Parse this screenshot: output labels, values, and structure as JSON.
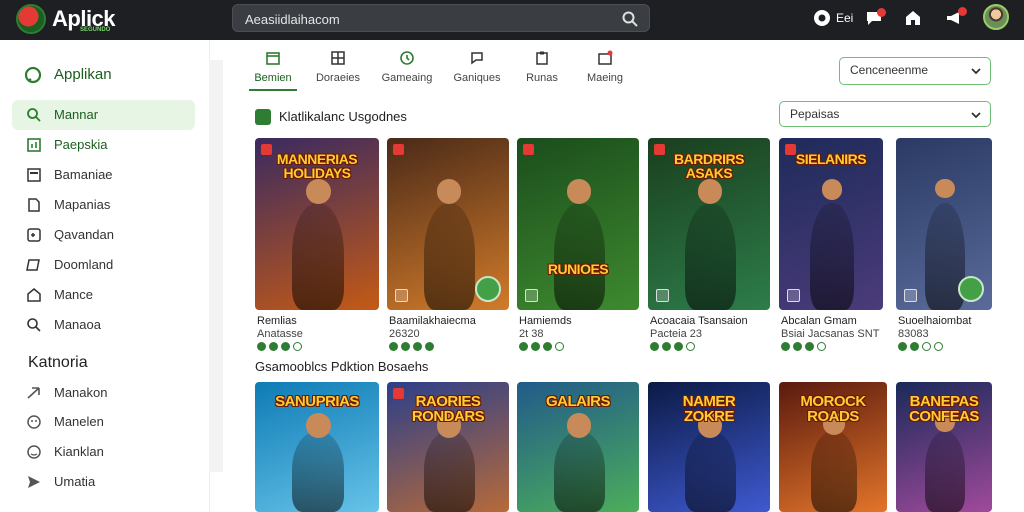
{
  "app": {
    "logo_text": "Aplick",
    "logo_sub": "SEGUNDO",
    "search_value": "Aeasiidlaihacom",
    "notification_count": "Eei"
  },
  "sidebar": {
    "brand": "Applikan",
    "items": [
      {
        "label": "Mannar",
        "icon": "search-icon"
      },
      {
        "label": "Paepskia",
        "icon": "chart-icon"
      },
      {
        "label": "Bamaniae",
        "icon": "list-icon"
      },
      {
        "label": "Mapanias",
        "icon": "document-icon"
      },
      {
        "label": "Qavandan",
        "icon": "gamepad-icon"
      },
      {
        "label": "Doomland",
        "icon": "card-icon"
      },
      {
        "label": "Mance",
        "icon": "home-icon"
      },
      {
        "label": "Manaoa",
        "icon": "search-icon"
      }
    ],
    "category_title": "Katnoria",
    "categories": [
      {
        "label": "Manakon",
        "icon": "arrow-icon"
      },
      {
        "label": "Manelen",
        "icon": "smile-icon"
      },
      {
        "label": "Kianklan",
        "icon": "emoji-icon"
      },
      {
        "label": "Umatia",
        "icon": "send-icon"
      }
    ]
  },
  "tabs": [
    {
      "label": "Bemien"
    },
    {
      "label": "Doraeies"
    },
    {
      "label": "Gameaing"
    },
    {
      "label": "Ganiques"
    },
    {
      "label": "Runas"
    },
    {
      "label": "Maeing"
    }
  ],
  "filters": {
    "top_select": "Cenceneenme",
    "section_select": "Pepaisas"
  },
  "sections": {
    "featured_title": "Klatlikalanc Usgodnes",
    "popular_title": "Gsamooblcs Pdktion Bosaehs"
  },
  "featured_cards": [
    {
      "art": "MANNERIAS HOLIDAYS",
      "name": "Remlias",
      "meta": "Anatasse",
      "rating": 3,
      "colors": [
        "#3a2a60",
        "#c45a16"
      ]
    },
    {
      "art": "",
      "name": "Baamilakhaiecma",
      "meta": "26320",
      "rating": 4,
      "colors": [
        "#4a2a18",
        "#d27b2a"
      ]
    },
    {
      "art": "RUNIOES",
      "name": "Hamiemds",
      "meta": "2t 38",
      "rating": 3,
      "colors": [
        "#1b4d1c",
        "#3e8a2f"
      ]
    },
    {
      "art": "BARDRIRS ASAKS",
      "name": "Acoacaia Tsansaion",
      "meta": "Pacteia 23",
      "rating": 3,
      "colors": [
        "#1a3f1e",
        "#2d7d4a"
      ]
    },
    {
      "art": "SIELANIRS",
      "name": "Abcalan Gmam",
      "meta": "Bsiai Jacsanas SNT",
      "rating": 3,
      "colors": [
        "#1e2b5a",
        "#4b3b7a"
      ]
    },
    {
      "art": "",
      "name": "Suoelhaiombat",
      "meta": "83083",
      "rating": 2,
      "colors": [
        "#2a3a64",
        "#5a6a9a"
      ]
    }
  ],
  "popular_cards": [
    {
      "art": "SANUPRIAS",
      "colors": [
        "#0e7bb5",
        "#66c3e8"
      ]
    },
    {
      "art": "RAORIES RONDARS",
      "colors": [
        "#2b3f8a",
        "#b76a3a"
      ]
    },
    {
      "art": "GALAIRS",
      "colors": [
        "#215a8a",
        "#4cae5a"
      ]
    },
    {
      "art": "NAMER ZOKRE",
      "colors": [
        "#0b1a45",
        "#3f5ad1"
      ]
    },
    {
      "art": "MOROCK ROADS",
      "colors": [
        "#5a1a0e",
        "#e3752a"
      ]
    },
    {
      "art": "BANEPAS CONFEAS",
      "colors": [
        "#1a2a5a",
        "#a04a9a"
      ]
    }
  ]
}
